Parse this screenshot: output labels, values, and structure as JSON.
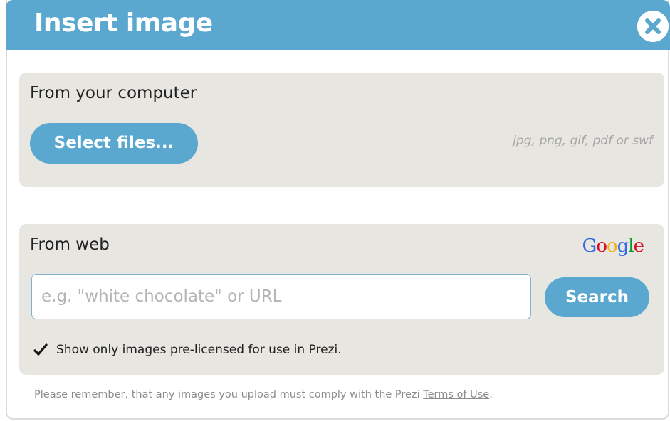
{
  "dialog": {
    "title": "Insert image",
    "colors": {
      "header": "#5aa8cf",
      "panel": "#e8e6e0",
      "button": "#5aa8cf"
    }
  },
  "computer_section": {
    "heading": "From your computer",
    "select_button": "Select files...",
    "formats": "jpg, png, gif, pdf or swf"
  },
  "web_section": {
    "heading": "From web",
    "provider": [
      "G",
      "o",
      "o",
      "g",
      "l",
      "e"
    ],
    "search_placeholder": "e.g. \"white chocolate\" or URL",
    "search_value": "",
    "search_button": "Search",
    "license_checked": true,
    "license_label": "Show only images pre-licensed for use in Prezi."
  },
  "footer": {
    "note": "Please remember, that any images you upload must comply with the Prezi ",
    "terms_link": "Terms of Use",
    "note_end": "."
  }
}
